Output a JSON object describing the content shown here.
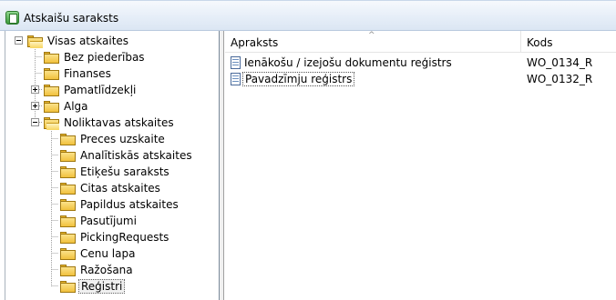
{
  "window": {
    "title": "Atskaišu saraksts",
    "icon": "report-app-icon"
  },
  "tree": {
    "root": {
      "label": "Visas atskaites",
      "expanded": true,
      "children": [
        {
          "label": "Bez piederības"
        },
        {
          "label": "Finanses"
        },
        {
          "label": "Pamatlīdzekļi",
          "expandable": true
        },
        {
          "label": "Alga",
          "expandable": true
        },
        {
          "label": "Noliktavas atskaites",
          "expanded": true,
          "children": [
            {
              "label": "Preces uzskaite"
            },
            {
              "label": "Analītiskās atskaites"
            },
            {
              "label": "Etiķešu saraksts"
            },
            {
              "label": "Citas atskaites"
            },
            {
              "label": "Papildus atskaites"
            },
            {
              "label": "Pasutījumi"
            },
            {
              "label": "PickingRequests"
            },
            {
              "label": "Cenu lapa"
            },
            {
              "label": "Ražošana"
            },
            {
              "label": "Reģistri",
              "selected": true
            }
          ]
        }
      ]
    }
  },
  "list": {
    "columns": [
      "Apraksts",
      "Kods"
    ],
    "rows": [
      {
        "description": "Ienākošu / izejošu dokumentu reģistrs",
        "code": "WO_0134_R"
      },
      {
        "description": "Pavadzīmju reģistrs",
        "code": "WO_0132_R",
        "focused": true
      }
    ],
    "sort_indicator": "^"
  }
}
